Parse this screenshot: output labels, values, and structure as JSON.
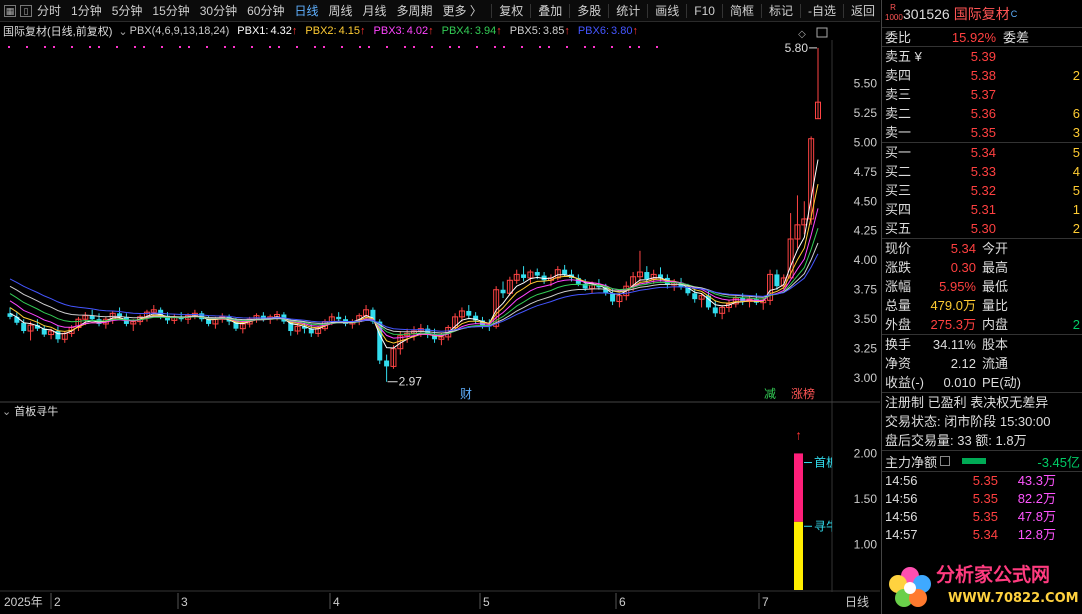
{
  "toolbar": {
    "left_items": [
      "分时",
      "1分钟",
      "5分钟",
      "15分钟",
      "30分钟",
      "60分钟",
      "日线",
      "周线",
      "月线",
      "多周期",
      "更多 〉"
    ],
    "active_item": "日线",
    "right_items": [
      "复权",
      "叠加",
      "多股",
      "统计",
      "画线",
      "F10",
      "简框",
      "标记",
      "-自选",
      "返回"
    ]
  },
  "chart_header": {
    "title": "国际复材(日线,前复权)",
    "indicator": "PBX(4,6,9,13,18,24)",
    "pbx": [
      {
        "label": "PBX1:",
        "value": "4.32",
        "color": "#ffffff"
      },
      {
        "label": "PBX2:",
        "value": "4.15",
        "color": "#ffcc33"
      },
      {
        "label": "PBX3:",
        "value": "4.02",
        "color": "#ff44ff"
      },
      {
        "label": "PBX4:",
        "value": "3.94",
        "color": "#33cc55"
      },
      {
        "label": "PBX5:",
        "value": "3.85",
        "color": "#cfcfcf"
      },
      {
        "label": "PBX6:",
        "value": "3.80",
        "color": "#4455ff"
      }
    ]
  },
  "sub_chart": {
    "title": "首板寻牛",
    "y_ticks": [
      "2.00",
      "1.50",
      "1.00"
    ],
    "labels": [
      "首板",
      "寻牛"
    ]
  },
  "chart_data": {
    "type": "candlestick",
    "y_ticks": [
      "5.50",
      "5.25",
      "5.00",
      "4.75",
      "4.50",
      "4.25",
      "4.00",
      "3.75",
      "3.50",
      "3.25",
      "3.00"
    ],
    "ylim": [
      2.9,
      5.85
    ],
    "high_label": "5.80",
    "low_label": "2.97",
    "markers": [
      "财",
      "减",
      "涨榜"
    ],
    "x_ticks": [
      "2025年",
      "2",
      "3",
      "4",
      "5",
      "6",
      "7",
      "日线"
    ],
    "ohlc": [
      [
        3.55,
        3.6,
        3.5,
        3.52
      ],
      [
        3.52,
        3.56,
        3.45,
        3.47
      ],
      [
        3.47,
        3.5,
        3.38,
        3.4
      ],
      [
        3.4,
        3.48,
        3.32,
        3.45
      ],
      [
        3.45,
        3.5,
        3.4,
        3.42
      ],
      [
        3.42,
        3.45,
        3.35,
        3.37
      ],
      [
        3.37,
        3.42,
        3.33,
        3.4
      ],
      [
        3.4,
        3.44,
        3.3,
        3.33
      ],
      [
        3.33,
        3.4,
        3.3,
        3.38
      ],
      [
        3.38,
        3.45,
        3.35,
        3.43
      ],
      [
        3.43,
        3.52,
        3.4,
        3.5
      ],
      [
        3.5,
        3.56,
        3.45,
        3.53
      ],
      [
        3.53,
        3.58,
        3.48,
        3.5
      ],
      [
        3.5,
        3.55,
        3.44,
        3.46
      ],
      [
        3.46,
        3.52,
        3.42,
        3.5
      ],
      [
        3.5,
        3.57,
        3.46,
        3.55
      ],
      [
        3.55,
        3.6,
        3.5,
        3.52
      ],
      [
        3.52,
        3.55,
        3.44,
        3.46
      ],
      [
        3.46,
        3.5,
        3.4,
        3.48
      ],
      [
        3.48,
        3.54,
        3.45,
        3.52
      ],
      [
        3.52,
        3.58,
        3.48,
        3.56
      ],
      [
        3.56,
        3.62,
        3.52,
        3.58
      ],
      [
        3.58,
        3.6,
        3.5,
        3.53
      ],
      [
        3.53,
        3.56,
        3.46,
        3.49
      ],
      [
        3.49,
        3.54,
        3.46,
        3.52
      ],
      [
        3.52,
        3.56,
        3.48,
        3.5
      ],
      [
        3.5,
        3.55,
        3.46,
        3.53
      ],
      [
        3.53,
        3.58,
        3.5,
        3.55
      ],
      [
        3.55,
        3.57,
        3.48,
        3.5
      ],
      [
        3.5,
        3.53,
        3.44,
        3.46
      ],
      [
        3.46,
        3.52,
        3.42,
        3.5
      ],
      [
        3.5,
        3.55,
        3.47,
        3.52
      ],
      [
        3.52,
        3.54,
        3.45,
        3.48
      ],
      [
        3.48,
        3.51,
        3.4,
        3.42
      ],
      [
        3.42,
        3.48,
        3.38,
        3.46
      ],
      [
        3.46,
        3.52,
        3.43,
        3.5
      ],
      [
        3.5,
        3.55,
        3.47,
        3.53
      ],
      [
        3.53,
        3.56,
        3.48,
        3.5
      ],
      [
        3.5,
        3.54,
        3.46,
        3.52
      ],
      [
        3.52,
        3.57,
        3.49,
        3.54
      ],
      [
        3.54,
        3.56,
        3.46,
        3.48
      ],
      [
        3.48,
        3.5,
        3.36,
        3.4
      ],
      [
        3.4,
        3.46,
        3.37,
        3.44
      ],
      [
        3.44,
        3.48,
        3.38,
        3.42
      ],
      [
        3.42,
        3.46,
        3.35,
        3.38
      ],
      [
        3.38,
        3.44,
        3.35,
        3.42
      ],
      [
        3.42,
        3.5,
        3.4,
        3.48
      ],
      [
        3.48,
        3.55,
        3.45,
        3.52
      ],
      [
        3.52,
        3.56,
        3.48,
        3.5
      ],
      [
        3.5,
        3.53,
        3.44,
        3.46
      ],
      [
        3.46,
        3.5,
        3.42,
        3.48
      ],
      [
        3.48,
        3.55,
        3.45,
        3.53
      ],
      [
        3.53,
        3.62,
        3.5,
        3.58
      ],
      [
        3.58,
        3.6,
        3.46,
        3.48
      ],
      [
        3.48,
        3.5,
        3.12,
        3.15
      ],
      [
        3.15,
        3.2,
        2.97,
        3.1
      ],
      [
        3.1,
        3.28,
        3.08,
        3.25
      ],
      [
        3.25,
        3.4,
        3.2,
        3.36
      ],
      [
        3.36,
        3.42,
        3.3,
        3.38
      ],
      [
        3.38,
        3.44,
        3.32,
        3.4
      ],
      [
        3.4,
        3.46,
        3.35,
        3.42
      ],
      [
        3.42,
        3.45,
        3.34,
        3.37
      ],
      [
        3.37,
        3.42,
        3.3,
        3.33
      ],
      [
        3.33,
        3.38,
        3.28,
        3.35
      ],
      [
        3.35,
        3.45,
        3.32,
        3.43
      ],
      [
        3.43,
        3.55,
        3.4,
        3.52
      ],
      [
        3.52,
        3.6,
        3.48,
        3.57
      ],
      [
        3.57,
        3.62,
        3.5,
        3.53
      ],
      [
        3.53,
        3.56,
        3.46,
        3.49
      ],
      [
        3.49,
        3.52,
        3.42,
        3.45
      ],
      [
        3.45,
        3.5,
        3.4,
        3.44
      ],
      [
        3.44,
        3.78,
        3.42,
        3.75
      ],
      [
        3.75,
        3.82,
        3.68,
        3.72
      ],
      [
        3.72,
        3.86,
        3.7,
        3.83
      ],
      [
        3.83,
        3.92,
        3.8,
        3.88
      ],
      [
        3.88,
        3.95,
        3.82,
        3.85
      ],
      [
        3.85,
        3.92,
        3.8,
        3.9
      ],
      [
        3.9,
        3.93,
        3.84,
        3.87
      ],
      [
        3.87,
        3.9,
        3.8,
        3.83
      ],
      [
        3.83,
        3.88,
        3.78,
        3.85
      ],
      [
        3.85,
        3.95,
        3.83,
        3.92
      ],
      [
        3.92,
        3.96,
        3.86,
        3.88
      ],
      [
        3.88,
        3.92,
        3.82,
        3.85
      ],
      [
        3.85,
        3.88,
        3.78,
        3.8
      ],
      [
        3.8,
        3.84,
        3.74,
        3.76
      ],
      [
        3.76,
        3.82,
        3.72,
        3.79
      ],
      [
        3.79,
        3.84,
        3.75,
        3.77
      ],
      [
        3.77,
        3.8,
        3.7,
        3.72
      ],
      [
        3.72,
        3.76,
        3.62,
        3.65
      ],
      [
        3.65,
        3.72,
        3.6,
        3.7
      ],
      [
        3.7,
        3.82,
        3.66,
        3.78
      ],
      [
        3.78,
        3.9,
        3.74,
        3.86
      ],
      [
        3.86,
        4.08,
        3.82,
        3.9
      ],
      [
        3.9,
        3.95,
        3.8,
        3.84
      ],
      [
        3.84,
        3.92,
        3.8,
        3.88
      ],
      [
        3.88,
        3.94,
        3.82,
        3.85
      ],
      [
        3.85,
        3.88,
        3.76,
        3.79
      ],
      [
        3.79,
        3.84,
        3.74,
        3.81
      ],
      [
        3.81,
        3.85,
        3.75,
        3.77
      ],
      [
        3.77,
        3.8,
        3.7,
        3.72
      ],
      [
        3.72,
        3.76,
        3.64,
        3.67
      ],
      [
        3.67,
        3.72,
        3.6,
        3.7
      ],
      [
        3.7,
        3.74,
        3.58,
        3.6
      ],
      [
        3.6,
        3.66,
        3.52,
        3.55
      ],
      [
        3.55,
        3.62,
        3.5,
        3.6
      ],
      [
        3.6,
        3.66,
        3.56,
        3.63
      ],
      [
        3.63,
        3.7,
        3.6,
        3.68
      ],
      [
        3.68,
        3.72,
        3.62,
        3.65
      ],
      [
        3.65,
        3.7,
        3.6,
        3.67
      ],
      [
        3.67,
        3.72,
        3.62,
        3.64
      ],
      [
        3.64,
        3.68,
        3.58,
        3.66
      ],
      [
        3.66,
        3.92,
        3.62,
        3.88
      ],
      [
        3.88,
        3.92,
        3.75,
        3.78
      ],
      [
        3.78,
        3.88,
        3.75,
        3.85
      ],
      [
        3.85,
        4.4,
        3.85,
        4.18
      ],
      [
        4.18,
        4.55,
        4.1,
        4.3
      ],
      [
        4.3,
        4.5,
        4.22,
        4.35
      ],
      [
        4.35,
        5.05,
        4.3,
        5.03
      ],
      [
        5.2,
        5.8,
        5.2,
        5.34
      ]
    ]
  },
  "panel": {
    "stock_badge": "R 1000",
    "stock_code": "301526",
    "stock_name": "国际复材",
    "weibi": {
      "label": "委比",
      "value": "15.92%",
      "label2": "委差"
    },
    "asks": [
      {
        "label": "卖五 ¥",
        "price": "5.39",
        "vol": ""
      },
      {
        "label": "卖四",
        "price": "5.38",
        "vol": "2"
      },
      {
        "label": "卖三",
        "price": "5.37",
        "vol": ""
      },
      {
        "label": "卖二",
        "price": "5.36",
        "vol": "6"
      },
      {
        "label": "卖一",
        "price": "5.35",
        "vol": "3"
      }
    ],
    "bids": [
      {
        "label": "买一",
        "price": "5.34",
        "vol": "5"
      },
      {
        "label": "买二",
        "price": "5.33",
        "vol": "4"
      },
      {
        "label": "买三",
        "price": "5.32",
        "vol": "5"
      },
      {
        "label": "买四",
        "price": "5.31",
        "vol": "1"
      },
      {
        "label": "买五",
        "price": "5.30",
        "vol": "2"
      }
    ],
    "quote": [
      {
        "k": "现价",
        "v": "5.34",
        "vc": "red",
        "k2": "今开"
      },
      {
        "k": "涨跌",
        "v": "0.30",
        "vc": "red",
        "k2": "最高"
      },
      {
        "k": "涨幅",
        "v": "5.95%",
        "vc": "red",
        "k2": "最低"
      },
      {
        "k": "总量",
        "v": "479.0万",
        "vc": "yellow",
        "k2": "量比"
      },
      {
        "k": "外盘",
        "v": "275.3万",
        "vc": "red",
        "k2": "内盘",
        "v2": "2"
      }
    ],
    "fund": [
      {
        "k": "换手",
        "v": "34.11%",
        "vc": "white",
        "k2": "股本"
      },
      {
        "k": "净资",
        "v": "2.12",
        "vc": "white",
        "k2": "流通"
      },
      {
        "k": "收益(-)",
        "v": "0.010",
        "vc": "white",
        "k2": "PE(动)"
      }
    ],
    "info_lines": [
      "注册制 已盈利 表决权无差异",
      "交易状态: 闭市阶段 15:30:00",
      "盘后交易量: 33  额: 1.8万"
    ],
    "main_flow": {
      "label": "主力净额",
      "value": "-3.45亿"
    },
    "ticks": [
      {
        "t": "14:56",
        "p": "5.35",
        "q": "43.3万"
      },
      {
        "t": "14:56",
        "p": "5.35",
        "q": "82.2万"
      },
      {
        "t": "14:56",
        "p": "5.35",
        "q": "47.8万"
      },
      {
        "t": "14:57",
        "p": "5.34",
        "q": "12.8万"
      }
    ],
    "logo_text": "分析家公式网",
    "logo_url": "WWW.70822.COM"
  }
}
